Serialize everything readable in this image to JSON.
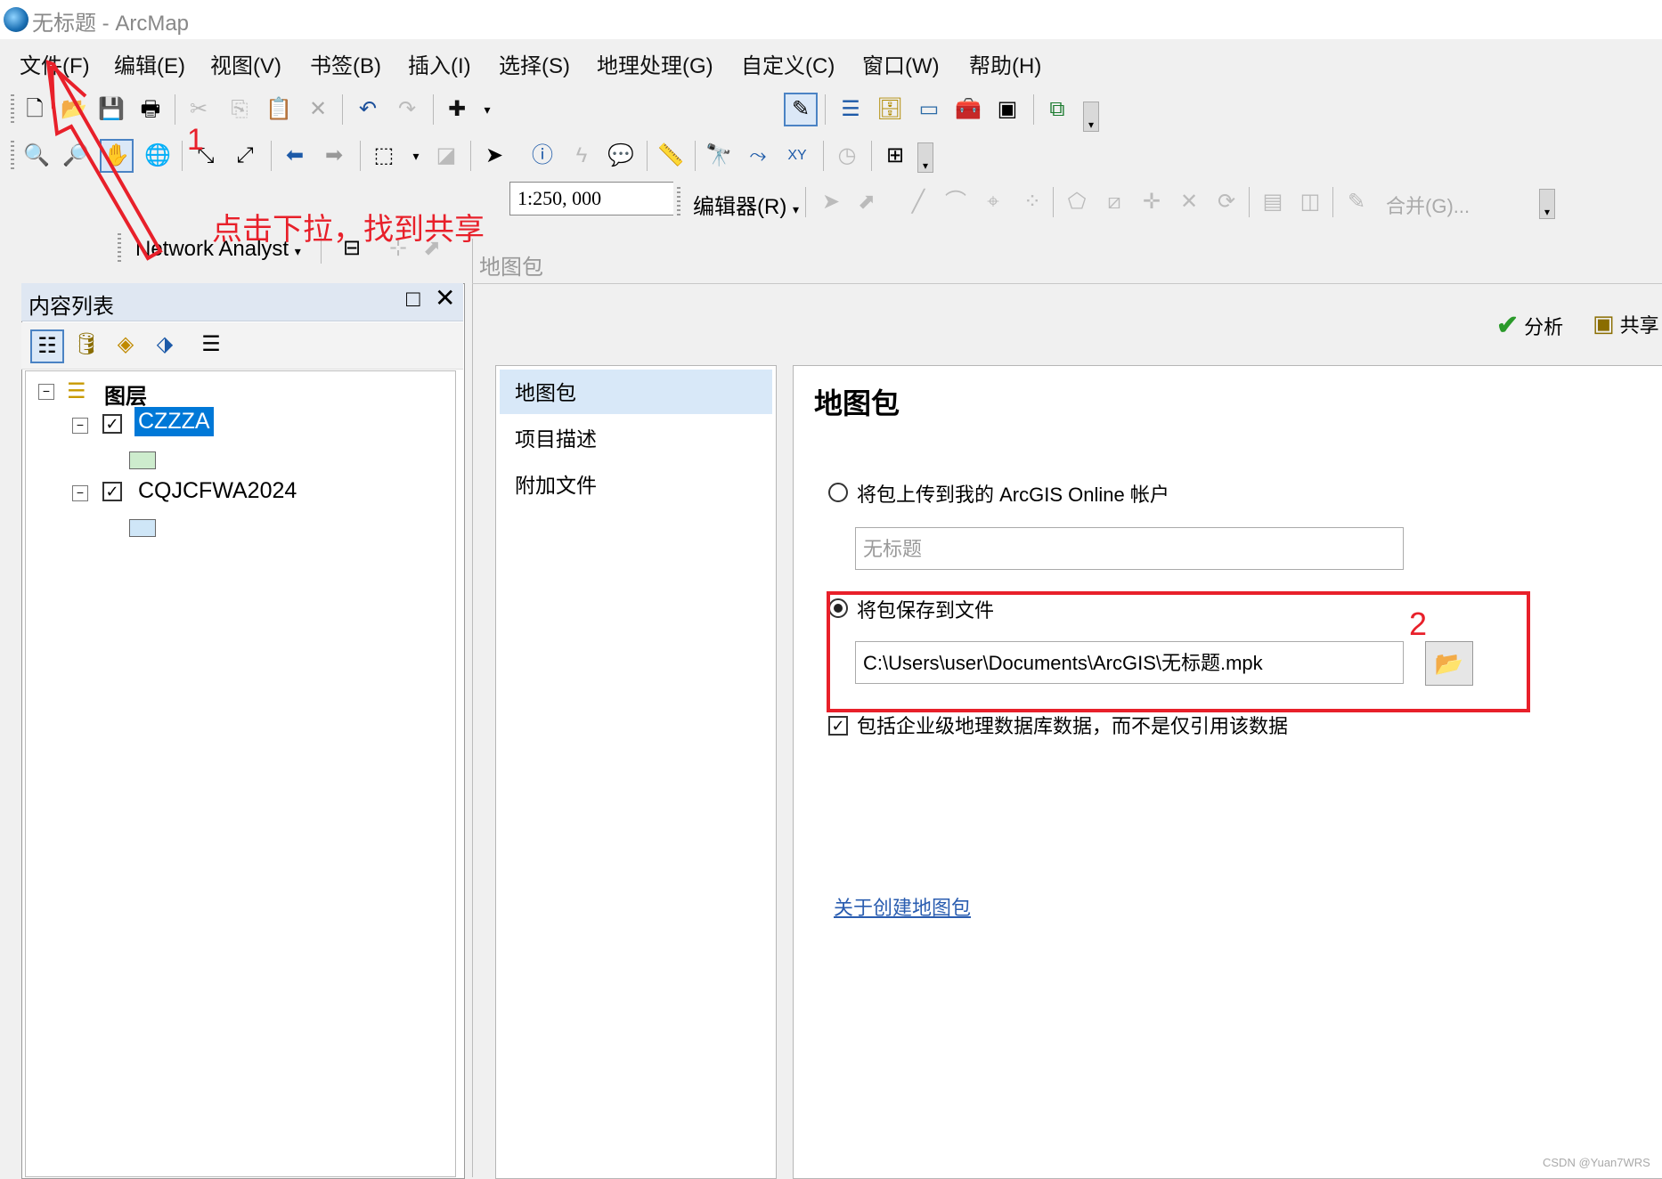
{
  "window": {
    "title": "无标题 - ArcMap"
  },
  "menubar": {
    "items": [
      "文件(F)",
      "编辑(E)",
      "视图(V)",
      "书签(B)",
      "插入(I)",
      "选择(S)",
      "地理处理(G)",
      "自定义(C)",
      "窗口(W)",
      "帮助(H)"
    ]
  },
  "toolbar": {
    "scale_value": "1:250, 000",
    "editor_label": "编辑器(R)",
    "merge_label": "合并(G)...",
    "network_analyst_label": "Network Analyst"
  },
  "toc": {
    "title": "内容列表",
    "root_label": "图层",
    "layers": [
      {
        "name": "CZZZA",
        "selected": true,
        "symbol_color": "#cdeccd"
      },
      {
        "name": "CQJCFWA2024",
        "selected": false,
        "symbol_color": "#cfe6f7"
      }
    ]
  },
  "dialog": {
    "title": "地图包",
    "analyze_label": "分析",
    "share_label": "共享",
    "nav_items": [
      "地图包",
      "项目描述",
      "附加文件"
    ],
    "heading": "地图包",
    "option_upload_label": "将包上传到我的 ArcGIS Online 帐户",
    "upload_name_value": "无标题",
    "option_save_label": "将包保存到文件",
    "save_path_value": "C:\\Users\\user\\Documents\\ArcGIS\\无标题.mpk",
    "include_enterprise_label": "包括企业级地理数据库数据，而不是仅引用该数据",
    "about_link": "关于创建地图包"
  },
  "annotations": {
    "step1_number": "1",
    "step1_note": "点击下拉，找到共享",
    "step2_number": "2",
    "color": "#e8202a"
  },
  "watermark": "CSDN @Yuan7WRS"
}
